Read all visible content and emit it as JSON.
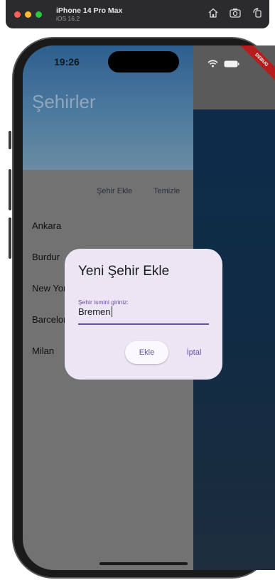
{
  "simulator": {
    "device_name": "iPhone 14 Pro Max",
    "os_version": "iOS 16.2",
    "controls": [
      "home-icon",
      "screenshot-icon",
      "rotate-icon"
    ]
  },
  "status_bar": {
    "time": "19:26",
    "icons": [
      "wifi-icon",
      "battery-icon"
    ]
  },
  "debug_banner": "DEBUG",
  "drawer": {
    "title": "Şehirler",
    "actions": {
      "add_label": "Şehir Ekle",
      "clear_label": "Temizle"
    },
    "cities": [
      "Ankara",
      "Burdur",
      "New York",
      "Barcelona",
      "Milan"
    ]
  },
  "dialog": {
    "title": "Yeni Şehir Ekle",
    "field_label": "Şehir ismini giriniz:",
    "field_value": "Bremen",
    "confirm_label": "Ekle",
    "cancel_label": "İptal"
  },
  "colors": {
    "accent": "#6750a4",
    "dialog_bg": "#ece5f3",
    "header_blue": "#2d5f8f",
    "debug_red": "#b71c1c"
  }
}
